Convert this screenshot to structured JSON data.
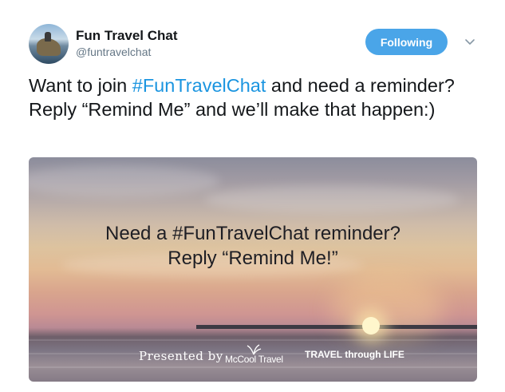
{
  "author": {
    "display_name": "Fun Travel Chat",
    "screen_name": "@funtravelchat"
  },
  "follow_button": {
    "label": "Following"
  },
  "tweet": {
    "text_before": "Want to join ",
    "hashtag": "#FunTravelChat",
    "text_after": " and need a reminder? Reply “Remind Me” and we’ll make that happen:)"
  },
  "media": {
    "overlay_line1": "Need a #FunTravelChat reminder?",
    "overlay_line2": "Reply “Remind Me!”",
    "presented_by": "Presented by",
    "logo_1": "McCool Travel",
    "logo_2": "TRAVEL through LIFE"
  },
  "colors": {
    "accent": "#1b95e0",
    "follow_button_bg": "#4aa5e8",
    "secondary_text": "#657786"
  },
  "icons": {
    "caret": "chevron-down-icon"
  }
}
